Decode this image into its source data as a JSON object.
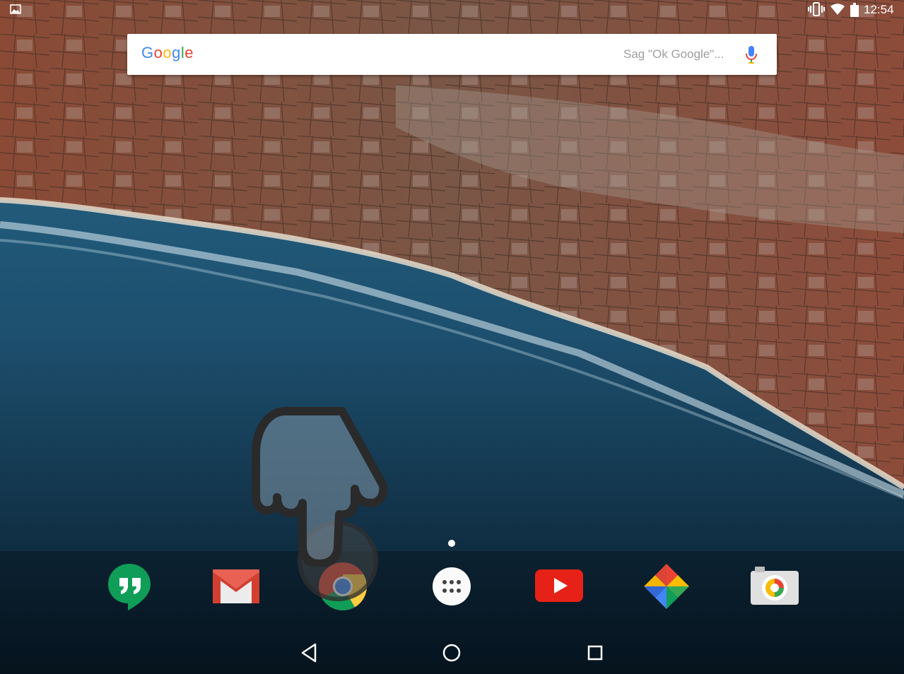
{
  "status_bar": {
    "time": "12:54",
    "icons": [
      "image-notification-icon",
      "vibrate-icon",
      "wifi-icon",
      "battery-icon"
    ]
  },
  "search": {
    "logo": "Google",
    "hint": "Sag \"Ok Google\"...",
    "mic_icon": "mic-icon"
  },
  "home": {
    "page_indicator_count": 1,
    "dock": [
      {
        "name": "Hangouts",
        "icon": "hangouts-icon"
      },
      {
        "name": "Gmail",
        "icon": "gmail-icon"
      },
      {
        "name": "Chrome",
        "icon": "chrome-icon"
      },
      {
        "name": "Apps",
        "icon": "app-drawer-icon"
      },
      {
        "name": "YouTube",
        "icon": "youtube-icon"
      },
      {
        "name": "Photos",
        "icon": "photos-icon"
      },
      {
        "name": "Camera",
        "icon": "camera-icon"
      }
    ]
  },
  "nav_bar": {
    "buttons": [
      "back-icon",
      "home-icon",
      "recents-icon"
    ]
  },
  "overlay": {
    "hand": "hand-pointer-icon",
    "tap_target": "Chrome"
  },
  "colors": {
    "google_blue": "#4285F4",
    "google_red": "#EA4335",
    "google_yellow": "#FBBC05",
    "google_green": "#34A853"
  }
}
